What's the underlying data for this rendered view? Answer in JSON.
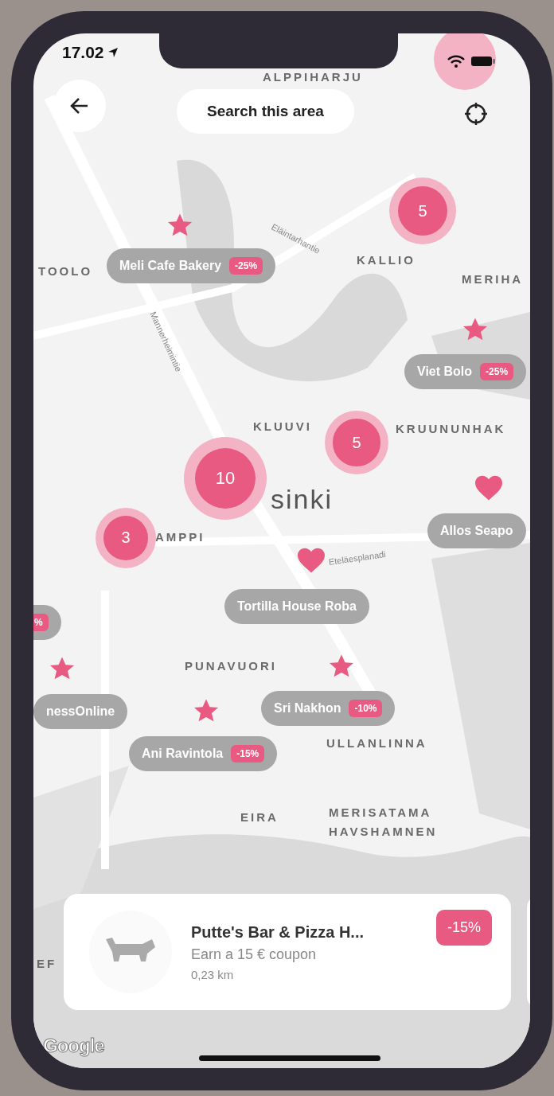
{
  "status_bar": {
    "time": "17.02"
  },
  "top_bar": {
    "search_button": "Search this area"
  },
  "map": {
    "place_labels": [
      {
        "text": "ALPPIHARJU"
      },
      {
        "text": "TOOLO"
      },
      {
        "text": "KALLIO"
      },
      {
        "text": "MERIHA"
      },
      {
        "text": "KLUUVI"
      },
      {
        "text": "KRUUNUNHAK"
      },
      {
        "text": "sinki",
        "kind": "city"
      },
      {
        "text": "AMPPI"
      },
      {
        "text": "PUNAVUORI"
      },
      {
        "text": "ULLANLINNA"
      },
      {
        "text": "EIRA"
      },
      {
        "text": "MERISATAMA"
      },
      {
        "text": "HAVSHAMNEN"
      },
      {
        "text": "EF"
      }
    ],
    "street_labels": [
      {
        "text": "Mannerheimintie"
      },
      {
        "text": "Eläintarhantie"
      },
      {
        "text": "Eteläesplanadi"
      }
    ],
    "clusters": [
      {
        "count": "5"
      },
      {
        "count": "5"
      },
      {
        "count": "10"
      },
      {
        "count": "3"
      }
    ],
    "markers": [
      {
        "kind": "star"
      },
      {
        "kind": "star"
      },
      {
        "kind": "heart"
      },
      {
        "kind": "heart"
      },
      {
        "kind": "star"
      },
      {
        "kind": "star"
      },
      {
        "kind": "star"
      }
    ],
    "venue_pills": [
      {
        "name": "Meli Cafe Bakery",
        "discount": "-25%"
      },
      {
        "name": "Viet Bolo",
        "discount": "-25%"
      },
      {
        "name": "Allos Seapo"
      },
      {
        "name": "Tortilla House Roba"
      },
      {
        "discount": "%"
      },
      {
        "name": "nessOnline"
      },
      {
        "name": "Sri Nakhon",
        "discount": "-10%"
      },
      {
        "name": "Ani Ravintola",
        "discount": "-15%"
      }
    ]
  },
  "venue_card": {
    "title": "Putte's Bar & Pizza H...",
    "subtitle": "Earn a 15 € coupon",
    "distance": "0,23 km",
    "discount": "-15%"
  },
  "map_attribution": "Google"
}
